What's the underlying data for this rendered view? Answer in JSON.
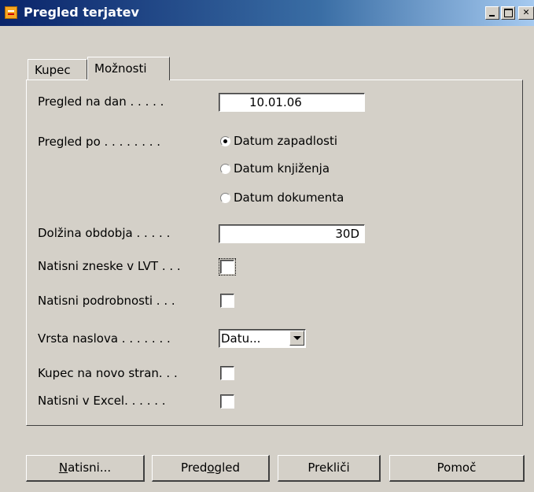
{
  "window": {
    "title": "Pregled terjatev",
    "minimize_glyph": "_",
    "maximize_glyph": "□",
    "close_glyph": "✕"
  },
  "tabs": [
    {
      "label": "Kupec",
      "active": false
    },
    {
      "label": "Možnosti",
      "active": true
    }
  ],
  "options": {
    "pregled_na_dan": {
      "label": "Pregled na dan . . . . .",
      "value": "10.01.06"
    },
    "pregled_po": {
      "label": "Pregled po . . . . . . . .",
      "choices": [
        "Datum zapadlosti",
        "Datum knjiženja",
        "Datum dokumenta"
      ],
      "selected": "Datum zapadlosti"
    },
    "dolzina_obdobja": {
      "label": "Dolžina obdobja . . . . .",
      "value": "30D"
    },
    "natisni_zneske_v_lvt": {
      "label": "Natisni zneske v LVT . . .",
      "checked": false
    },
    "natisni_podrobnosti": {
      "label": "Natisni podrobnosti . . .",
      "checked": false
    },
    "vrsta_naslova": {
      "label": "Vrsta naslova . . . . . . .",
      "value": "Datu..."
    },
    "kupec_na_novo_stran": {
      "label": "Kupec na novo stran. . .",
      "checked": false
    },
    "natisni_v_excel": {
      "label": "Natisni v Excel. . . . . .",
      "checked": false
    }
  },
  "buttons": {
    "print_pre": "",
    "print_u": "N",
    "print_post": "atisni...",
    "preview_pre": "Pred",
    "preview_u": "o",
    "preview_post": "gled",
    "cancel": "Prekliči",
    "help": "Pomoč"
  }
}
